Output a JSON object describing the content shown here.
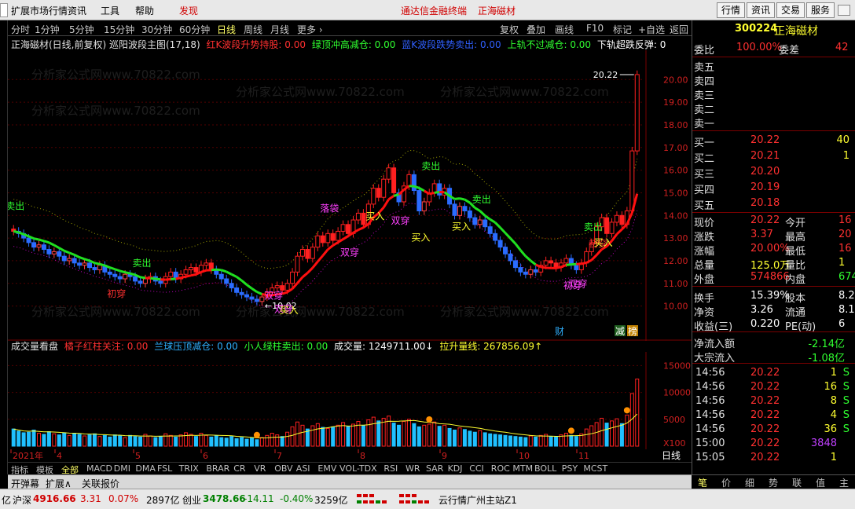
{
  "menu": {
    "items": [
      "扩展市场行情",
      "资讯",
      "工具",
      "帮助",
      "发现"
    ],
    "promo": "通达信金融终端",
    "stock_tab": "正海磁材",
    "right_buttons": [
      "行情",
      "资讯",
      "交易",
      "服务"
    ]
  },
  "toolbar": {
    "periods": [
      "分时",
      "1分钟",
      "5分钟",
      "15分钟",
      "30分钟",
      "60分钟",
      "日线",
      "周线",
      "月线",
      "更多 ›"
    ],
    "selected": "日线",
    "right": [
      "复权",
      "叠加",
      "画线",
      "F10",
      "标记",
      "+自选",
      "返回"
    ]
  },
  "main_header": {
    "title": "正海磁材(日线,前复权) 巡阳波段主图(17,18)",
    "items": [
      {
        "label": "红K波段升势持股: 0.00",
        "color": "#ff3030"
      },
      {
        "label": "绿顶冲高减仓: 0.00",
        "color": "#30ff30"
      },
      {
        "label": "蓝K波段跌势卖出: 0.00",
        "color": "#3060ff"
      },
      {
        "label": "上轨不过减仓: 0.00",
        "color": "#30ff30"
      },
      {
        "label": "下轨超跌反弹: 0",
        "color": "#ffffff"
      }
    ]
  },
  "price_axis": [
    "20.00",
    "19.00",
    "18.00",
    "17.00",
    "16.00",
    "15.00",
    "14.00",
    "13.00",
    "12.00",
    "11.00",
    "10.00"
  ],
  "annotations": {
    "high": "20.22",
    "low": "10.02",
    "labels": [
      "卖出",
      "初穿",
      "卖出",
      "双穿",
      "双穿",
      "买入",
      "落袋",
      "双穿",
      "买入",
      "双穿",
      "买入",
      "卖出",
      "买入",
      "卖出",
      "初穿",
      "双穿",
      "卖出",
      "初穿",
      "买入"
    ]
  },
  "markers": {
    "cai": "财",
    "jian": "减",
    "bang": "榜"
  },
  "vol_header": {
    "title": "成交量看盘",
    "items": [
      {
        "label": "橘子红柱关注: 0.00",
        "color": "#ff3030"
      },
      {
        "label": "兰球压顶减仓: 0.00",
        "color": "#30b0ff"
      },
      {
        "label": "小人绿柱卖出: 0.00",
        "color": "#30ff30"
      },
      {
        "label": "成交量: 1249711.00↓",
        "color": "#ffffff"
      },
      {
        "label": "拉升量线: 267856.09↑",
        "color": "#ffff30"
      }
    ]
  },
  "vol_axis": [
    "15000",
    "10000",
    "5000",
    "X100"
  ],
  "date_axis": [
    "2021年",
    "4",
    "5",
    "6",
    "7",
    "8",
    "9",
    "10",
    "11"
  ],
  "period_badge": "日线",
  "indicator_tabs": [
    "指标",
    "模板",
    "全部",
    "MACD",
    "DMI",
    "DMA",
    "FSL",
    "TRIX",
    "BRAR",
    "CR",
    "VR",
    "OBV",
    "ASI",
    "EMV",
    "VOL-TDX",
    "RSI",
    "WR",
    "SAR",
    "KDJ",
    "CCI",
    "ROC",
    "MTM",
    "BOLL",
    "PSY",
    "MCST"
  ],
  "indicator_selected": "全部",
  "bottom_tabs": [
    "开弹幕",
    "扩展∧",
    "关联报价"
  ],
  "quote": {
    "code": "300224",
    "name": "正海磁材",
    "weibi_label": "委比",
    "weibi": "100.00%",
    "weicha_label": "委差",
    "weicha": "42",
    "sells": [
      "卖五",
      "卖四",
      "卖三",
      "卖二",
      "卖一"
    ],
    "buys": [
      {
        "label": "买一",
        "price": "20.22",
        "vol": "40"
      },
      {
        "label": "买二",
        "price": "20.21",
        "vol": "1"
      },
      {
        "label": "买三",
        "price": "20.20",
        "vol": ""
      },
      {
        "label": "买四",
        "price": "20.19",
        "vol": ""
      },
      {
        "label": "买五",
        "price": "20.18",
        "vol": ""
      }
    ],
    "stats": [
      {
        "l1": "现价",
        "v1": "20.22",
        "c1": "#ff3030",
        "l2": "今开",
        "v2": "16",
        "c2": "#ff3030"
      },
      {
        "l1": "涨跌",
        "v1": "3.37",
        "c1": "#ff3030",
        "l2": "最高",
        "v2": "20",
        "c2": "#ff3030"
      },
      {
        "l1": "涨幅",
        "v1": "20.00%",
        "c1": "#ff3030",
        "l2": "最低",
        "v2": "16",
        "c2": "#ff3030"
      },
      {
        "l1": "总量",
        "v1": "125.0万",
        "c1": "#ffff30",
        "l2": "量比",
        "v2": "1",
        "c2": "#ffff30"
      },
      {
        "l1": "外盘",
        "v1": "574866",
        "c1": "#ff3030",
        "l2": "内盘",
        "v2": "674",
        "c2": "#30ff30"
      },
      {
        "l1": "换手",
        "v1": "15.39%",
        "c1": "#ffffff",
        "l2": "股本",
        "v2": "8.2",
        "c2": "#ffffff"
      },
      {
        "l1": "净资",
        "v1": "3.26",
        "c1": "#ffffff",
        "l2": "流通",
        "v2": "8.1",
        "c2": "#ffffff"
      },
      {
        "l1": "收益(三)",
        "v1": "0.220",
        "c1": "#ffffff",
        "l2": "PE(动)",
        "v2": "6",
        "c2": "#ffffff"
      }
    ],
    "flows": [
      {
        "label": "净流入额",
        "value": "-2.14亿"
      },
      {
        "label": "大宗流入",
        "value": "-1.08亿"
      }
    ],
    "ticks": [
      {
        "t": "14:56",
        "p": "20.22",
        "v": "1",
        "s": "S",
        "vc": "#ffff30"
      },
      {
        "t": "14:56",
        "p": "20.22",
        "v": "16",
        "s": "S",
        "vc": "#ffff30"
      },
      {
        "t": "14:56",
        "p": "20.22",
        "v": "8",
        "s": "S",
        "vc": "#ffff30"
      },
      {
        "t": "14:56",
        "p": "20.22",
        "v": "4",
        "s": "S",
        "vc": "#ffff30"
      },
      {
        "t": "14:56",
        "p": "20.22",
        "v": "36",
        "s": "S",
        "vc": "#ffff30"
      },
      {
        "t": "15:00",
        "p": "20.22",
        "v": "3848",
        "s": "",
        "vc": "#c040ff"
      },
      {
        "t": "15:05",
        "p": "20.22",
        "v": "1",
        "s": "",
        "vc": "#ffff30"
      }
    ],
    "bottom_tabs": [
      "笔",
      "价",
      "细",
      "势",
      "联",
      "值",
      "主"
    ],
    "bottom_selected": "笔"
  },
  "status": {
    "a_val": "亿",
    "sz_label": "沪深",
    "sz_val": "4916.66",
    "sz_chg": "3.31",
    "sz_pct": "0.07%",
    "sz_amt": "2897亿",
    "cy_label": "创业",
    "cy_val": "3478.66",
    "cy_chg": "-14.11",
    "cy_pct": "-0.40%",
    "cy_amt": "3259亿",
    "server": "云行情广州主站Z1"
  },
  "watermark": "分析家公式网www.70822.com",
  "chart_data": {
    "type": "candlestick",
    "title": "正海磁材(日线,前复权)",
    "ylim": [
      9.5,
      20.6
    ],
    "annotated_high": 20.22,
    "annotated_low": 10.02,
    "close": [
      13.3,
      13.2,
      13.0,
      12.8,
      12.6,
      12.7,
      12.5,
      12.3,
      12.4,
      12.2,
      12.0,
      12.1,
      11.9,
      11.8,
      11.9,
      11.7,
      11.6,
      11.8,
      11.5,
      11.4,
      11.3,
      11.2,
      11.4,
      11.3,
      11.1,
      11.0,
      11.2,
      11.3,
      11.1,
      11.0,
      11.3,
      11.5,
      11.2,
      11.4,
      11.6,
      11.7,
      11.5,
      11.8,
      11.9,
      11.6,
      11.4,
      11.2,
      11.0,
      10.8,
      10.6,
      10.5,
      10.4,
      10.3,
      10.2,
      10.4,
      10.6,
      10.8,
      10.9,
      10.7,
      11.0,
      11.5,
      12.2,
      12.5,
      12.1,
      12.6,
      13.1,
      12.8,
      13.2,
      12.9,
      13.3,
      13.6,
      13.2,
      13.8,
      14.1,
      13.6,
      14.5,
      15.2,
      14.8,
      15.6,
      16.1,
      15.0,
      14.6,
      15.3,
      15.8,
      15.1,
      14.2,
      14.6,
      15.0,
      15.4,
      14.9,
      15.2,
      14.5,
      14.0,
      14.4,
      14.2,
      13.9,
      13.6,
      13.8,
      13.5,
      13.2,
      12.9,
      12.6,
      12.3,
      12.0,
      11.7,
      11.5,
      11.4,
      11.6,
      11.5,
      11.8,
      12.0,
      11.9,
      11.7,
      11.9,
      12.1,
      11.8,
      11.6,
      11.9,
      12.4,
      12.8,
      13.5,
      13.9,
      13.2,
      13.7,
      14.0,
      13.6,
      14.2,
      16.85,
      20.22
    ],
    "volume": [
      3200,
      2800,
      2500,
      2600,
      3000,
      2400,
      2200,
      2700,
      2300,
      2100,
      2500,
      2000,
      2400,
      2200,
      1900,
      2100,
      2300,
      1800,
      2000,
      1700,
      2100,
      1900,
      1600,
      2000,
      1800,
      1700,
      2200,
      1900,
      1600,
      1800,
      2300,
      2000,
      1700,
      2100,
      2500,
      2200,
      1800,
      2400,
      2000,
      1700,
      1900,
      1600,
      1500,
      1800,
      1400,
      1600,
      1300,
      1500,
      1200,
      1600,
      2000,
      2400,
      2100,
      1800,
      2600,
      3600,
      4500,
      3900,
      3200,
      3800,
      4200,
      3500,
      3300,
      3600,
      3900,
      4400,
      3700,
      4100,
      4600,
      3800,
      4900,
      5400,
      4700,
      5200,
      5600,
      4300,
      3900,
      4600,
      5000,
      4200,
      3600,
      3900,
      4100,
      4500,
      3700,
      3900,
      3300,
      3000,
      3400,
      3100,
      2800,
      2600,
      2900,
      2500,
      2300,
      2200,
      2100,
      2000,
      1900,
      1800,
      1700,
      1600,
      1900,
      1700,
      2000,
      2200,
      1800,
      1700,
      2100,
      2400,
      2000,
      1800,
      2300,
      3200,
      3800,
      4400,
      5200,
      4300,
      4700,
      5100,
      4200,
      5800,
      9800,
      12497
    ]
  }
}
